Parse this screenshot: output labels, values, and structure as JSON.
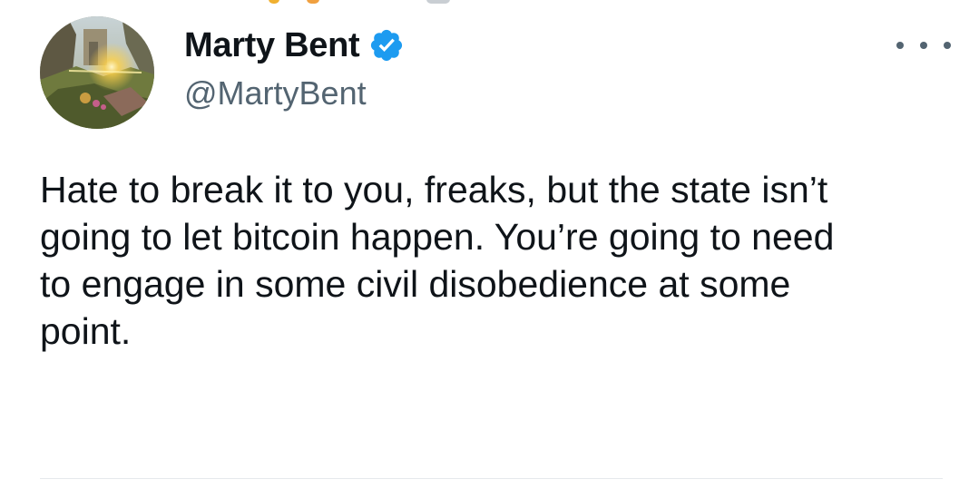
{
  "tweet": {
    "author": {
      "display_name": "Marty Bent",
      "handle": "@MartyBent",
      "verified": true,
      "verified_icon": "verified-badge-icon",
      "avatar_icon": "avatar"
    },
    "more_icon": "more-options-icon",
    "text": "Hate to break it to you, freaks, but the state isn’t\ngoing to let bitcoin happen. You’re going to need\nto engage in some civil disobedience at some\npoint."
  },
  "colors": {
    "verified_blue": "#1d9bf0",
    "text_primary": "#0f1419",
    "text_secondary": "#536471",
    "divider": "#e6e9ec"
  }
}
